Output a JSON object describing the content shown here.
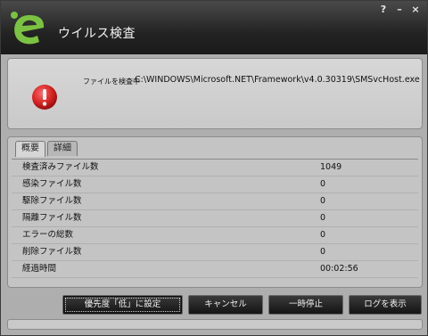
{
  "window": {
    "title": "ウイルス検査"
  },
  "window_buttons": {
    "help": "?",
    "minimize": "–",
    "close": "×"
  },
  "scan": {
    "label": "ファイルを検査中",
    "current_file": "C:\\WINDOWS\\Microsoft.NET\\Framework\\v4.0.30319\\SMSvcHost.exe"
  },
  "tabs": [
    {
      "label": "概要",
      "active": true
    },
    {
      "label": "詳細",
      "active": false
    }
  ],
  "stats": [
    {
      "label": "検査済みファイル数",
      "value": "1049"
    },
    {
      "label": "感染ファイル数",
      "value": "0"
    },
    {
      "label": "駆除ファイル数",
      "value": "0"
    },
    {
      "label": "隔離ファイル数",
      "value": "0"
    },
    {
      "label": "エラーの総数",
      "value": "0"
    },
    {
      "label": "削除ファイル数",
      "value": "0"
    },
    {
      "label": "経過時間",
      "value": "00:02:56"
    }
  ],
  "buttons": {
    "low_priority": "優先度「低」に設定",
    "cancel": "キャンセル",
    "pause": "一時停止",
    "show_log": "ログを表示"
  },
  "icons": {
    "logo": "logo-icon",
    "status": "error-icon"
  },
  "colors": {
    "titlebar": "#232323",
    "logo_green": "#7cc242",
    "error_red": "#d42020"
  }
}
